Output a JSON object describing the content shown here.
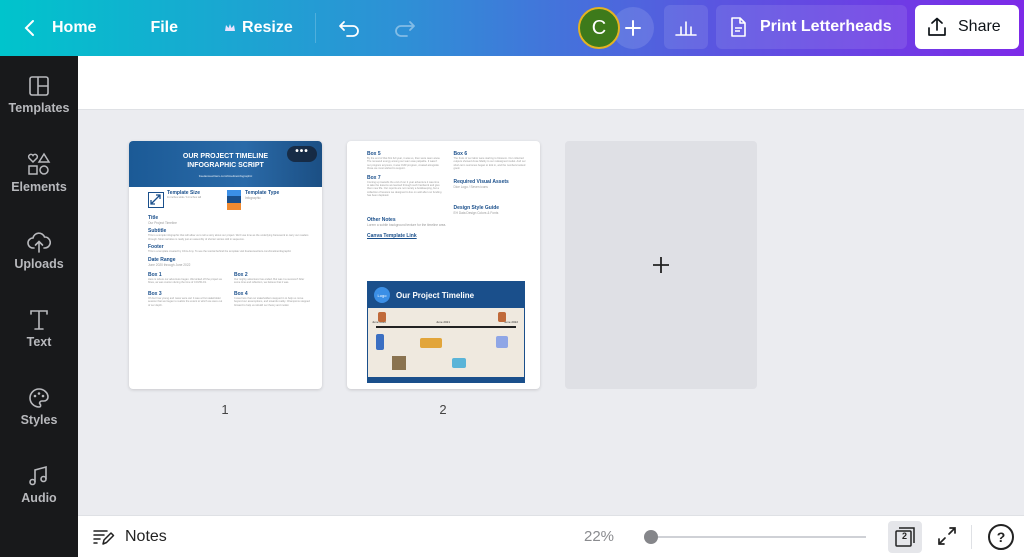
{
  "topbar": {
    "home_label": "Home",
    "file_label": "File",
    "resize_label": "Resize",
    "avatar_initial": "C",
    "print_label": "Print Letterheads",
    "share_label": "Share"
  },
  "sidebar": {
    "items": [
      {
        "label": "Templates",
        "icon": "templates-icon"
      },
      {
        "label": "Elements",
        "icon": "elements-icon"
      },
      {
        "label": "Uploads",
        "icon": "uploads-icon"
      },
      {
        "label": "Text",
        "icon": "text-icon"
      },
      {
        "label": "Styles",
        "icon": "styles-icon"
      },
      {
        "label": "Audio",
        "icon": "audio-icon"
      }
    ]
  },
  "pages": [
    {
      "number": "1",
      "header_title": "OUR PROJECT TIMELINE INFOGRAPHIC SCRIPT",
      "header_url": "freelancewriters.com/timelineinfographic",
      "template_size_label": "Template Size",
      "template_size_value": "11 inches wide / 11 inches tall",
      "template_type_label": "Template Type",
      "template_type_value": "Infographic",
      "sections": [
        {
          "title": "Title",
          "text": "Our Project Timeline"
        },
        {
          "title": "Subtitle",
          "text": "This is a simple infographic that will allow us to tell a story about our project. We'll use time as the underlying framework to carry our readers through. Most narrative is really just an assembly of shorter stories told in sequence."
        },
        {
          "title": "Footer",
          "text": "This is a template created by Chris Amy. To see the tutorial behind the template visit freelancewriters.com/timelineinfographic"
        },
        {
          "title": "Date Range",
          "text": "June 2020 through June 2022"
        }
      ],
      "boxes": [
        {
          "title": "Box 1",
          "text": "Here is where our adventure began. We kicked off the project as flows, as was custom during the time of COVID-19."
        },
        {
          "title": "Box 2",
          "text": "Our mighty adventure has ended. But was it a success? After some time and reflection, we believe that it was."
        },
        {
          "title": "Box 3",
          "text": "Oh but how young and naive were we! It was a first stakeholder session that we began to realize the extent to which we were out of our depth."
        },
        {
          "title": "Box 4",
          "text": "It was here that our stakeholders stepped in to help us move beyond our assumptions, and towards reality. Champions stepped forward to help us rebuild our theory and model."
        }
      ],
      "more_label": "more options"
    },
    {
      "number": "2",
      "boxes": [
        {
          "title": "Box 5",
          "text": "By the end of that first full year, it was us, then were team anew. The renewed energy among our team was palpable. It wasn't our program anymore, it was OUR program, created alongside those we most wished to support."
        },
        {
          "title": "Box 6",
          "text": "The fruits of our labor were starting to blossom. Our collected outputs showed close fidelity to our redesigned model. And our short-term outcomes began to kick in, and the numbers looked good."
        },
        {
          "title": "Box 7",
          "text": "Coming up towards the end of our 2 year adventure it was time to take the lessons we learned through such hardwork and give them new life. Our reports are not merely a bookkeeping, but a collection of lessons we designed to live on well after our funding has been depleted."
        }
      ],
      "required_assets_title": "Required Visual Assets",
      "required_assets_text": "Dice Logo / Seven icons",
      "design_guide_title": "Design Style Guide",
      "design_guide_text": "EH Data Design Colors & Fonts",
      "other_notes_title": "Other Notes",
      "other_notes_text": "Lorem a subtle background texture for the timeline area.",
      "canva_link_label": "Canva Template Link",
      "preview_title": "Our Project Timeline",
      "preview_logo": "Logo",
      "preview_dates": [
        "June 2020",
        "June 2021",
        "June 2022"
      ]
    }
  ],
  "add_page_label": "+",
  "bottombar": {
    "notes_label": "Notes",
    "zoom_level": "22%",
    "zoom_fraction": 0.0,
    "page_count": "2"
  },
  "colors": {
    "brand_start": "#00c4cc",
    "brand_end": "#7d2ae8",
    "sidebar_bg": "#18191b",
    "avatar_bg": "#3d7a1b",
    "avatar_ring": "#e3b322",
    "doc_blue": "#1a4f8b"
  }
}
